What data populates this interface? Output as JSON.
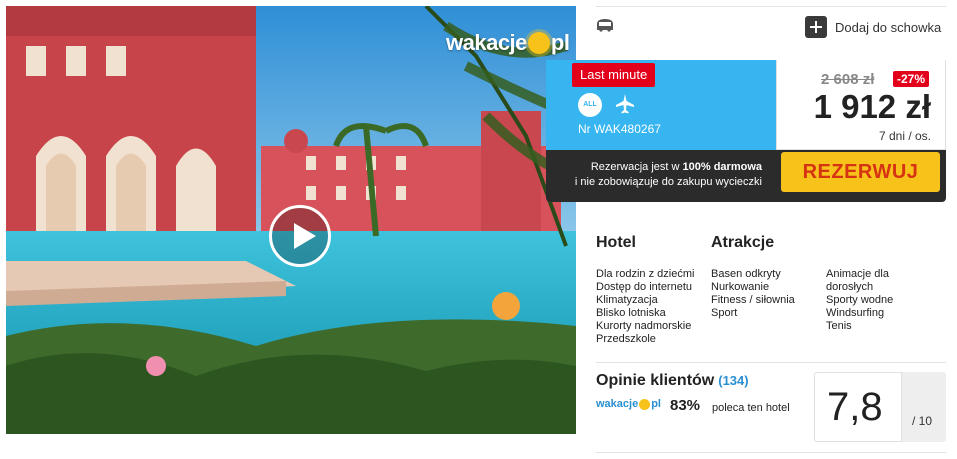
{
  "photo": {
    "logo": {
      "text_left": "wakacje",
      "text_right": "pl"
    },
    "play_icon": "play-icon"
  },
  "actions": {
    "clipboard_label": "Dodaj do schowka",
    "clipboard_icon": "plus-icon",
    "transport_icon": "bus-icon"
  },
  "offer": {
    "badge": "Last minute",
    "all_inclusive_icon": "all-inclusive-icon",
    "all_inclusive_text": "ALL INC",
    "flight_icon": "plane-icon",
    "offer_number": "Nr WAK480267",
    "old_price": "2 608 zł",
    "discount": "-27%",
    "price": "1 912 zł",
    "duration": "7 dni / os.",
    "free_text_prefix": "Rezerwacja jest w ",
    "free_text_bold": "100% darmowa",
    "free_text_suffix": "i nie zobowiązuje do zakupu wycieczki",
    "book_label": "REZERWUJ"
  },
  "features": {
    "hotel_heading": "Hotel",
    "attractions_heading": "Atrakcje",
    "hotel_items": [
      "Dla rodzin z dziećmi",
      "Dostęp do internetu",
      "Klimatyzacja",
      "Blisko lotniska",
      "Kurorty nadmorskie",
      "Przedszkole"
    ],
    "attractions_col1": [
      "Basen odkryty",
      "Nurkowanie",
      "Fitness / siłownia",
      "Sport"
    ],
    "attractions_col2": [
      "Animacje dla",
      "dorosłych",
      "Sporty wodne",
      "Windsurfing",
      "Tenis"
    ]
  },
  "reviews": {
    "title": "Opinie klientów",
    "count": "(134)",
    "logo_left": "wakacje",
    "logo_right": "pl",
    "recommend_percent": "83%",
    "recommend_text": "poleca ten hotel",
    "score": "7,8",
    "score_max": "/ 10"
  },
  "colors": {
    "offer_blue": "#36b5f0",
    "badge_red": "#e3001b",
    "book_yellow": "#f7c21a",
    "book_text": "#d63312",
    "dark_panel": "#2b2b2b",
    "link_blue": "#2a8fd0"
  }
}
